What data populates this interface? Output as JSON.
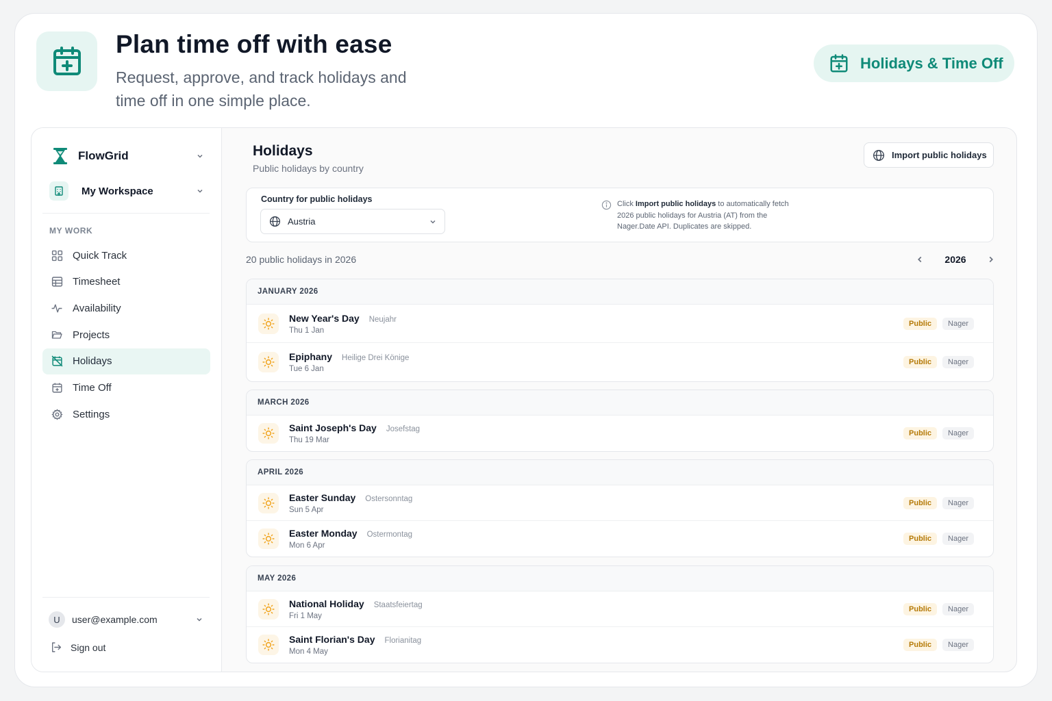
{
  "hero": {
    "title": "Plan time off with ease",
    "subtitle": "Request, approve, and track holidays and time off in one simple place.",
    "pill_label": "Holidays & Time Off"
  },
  "sidebar": {
    "brand": "FlowGrid",
    "workspace": "My Workspace",
    "section_label": "MY WORK",
    "items": [
      {
        "label": "Quick Track",
        "icon": "grid-icon"
      },
      {
        "label": "Timesheet",
        "icon": "table-icon"
      },
      {
        "label": "Availability",
        "icon": "activity-icon"
      },
      {
        "label": "Projects",
        "icon": "folder-icon"
      },
      {
        "label": "Holidays",
        "icon": "calendar-off-icon",
        "active": true
      },
      {
        "label": "Time Off",
        "icon": "calendar-plus-icon"
      },
      {
        "label": "Settings",
        "icon": "gear-icon"
      }
    ],
    "user": {
      "initial": "U",
      "email": "user@example.com"
    },
    "sign_out": "Sign out"
  },
  "main": {
    "title": "Holidays",
    "subtitle": "Public holidays by country",
    "import_button": "Import public holidays",
    "country_label": "Country for public holidays",
    "country_value": "Austria",
    "info_prefix": "Click ",
    "info_bold": "Import public holidays",
    "info_suffix": " to automatically fetch 2026 public holidays for Austria (AT) from the Nager.Date API. Duplicates are skipped.",
    "count_text": "20 public holidays in 2026",
    "year": "2026"
  },
  "months": [
    {
      "name": "JANUARY 2026",
      "holidays": [
        {
          "name": "New Year's Day",
          "local": "Neujahr",
          "date": "Thu 1 Jan",
          "type": "Public",
          "source": "Nager"
        },
        {
          "name": "Epiphany",
          "local": "Heilige Drei Könige",
          "date": "Tue 6 Jan",
          "type": "Public",
          "source": "Nager"
        }
      ]
    },
    {
      "name": "MARCH 2026",
      "holidays": [
        {
          "name": "Saint Joseph's Day",
          "local": "Josefstag",
          "date": "Thu 19 Mar",
          "type": "Public",
          "source": "Nager"
        }
      ]
    },
    {
      "name": "APRIL 2026",
      "holidays": [
        {
          "name": "Easter Sunday",
          "local": "Ostersonntag",
          "date": "Sun 5 Apr",
          "type": "Public",
          "source": "Nager"
        },
        {
          "name": "Easter Monday",
          "local": "Ostermontag",
          "date": "Mon 6 Apr",
          "type": "Public",
          "source": "Nager"
        }
      ]
    },
    {
      "name": "MAY 2026",
      "holidays": [
        {
          "name": "National Holiday",
          "local": "Staatsfeiertag",
          "date": "Fri 1 May",
          "type": "Public",
          "source": "Nager"
        },
        {
          "name": "Saint Florian's Day",
          "local": "Florianitag",
          "date": "Mon 4 May",
          "type": "Public",
          "source": "Nager"
        }
      ]
    }
  ],
  "colors": {
    "accent": "#0f8a78",
    "accent_bg": "#e6f5f2",
    "badge_public": "#b57a08",
    "sun": "#f0a21a"
  }
}
